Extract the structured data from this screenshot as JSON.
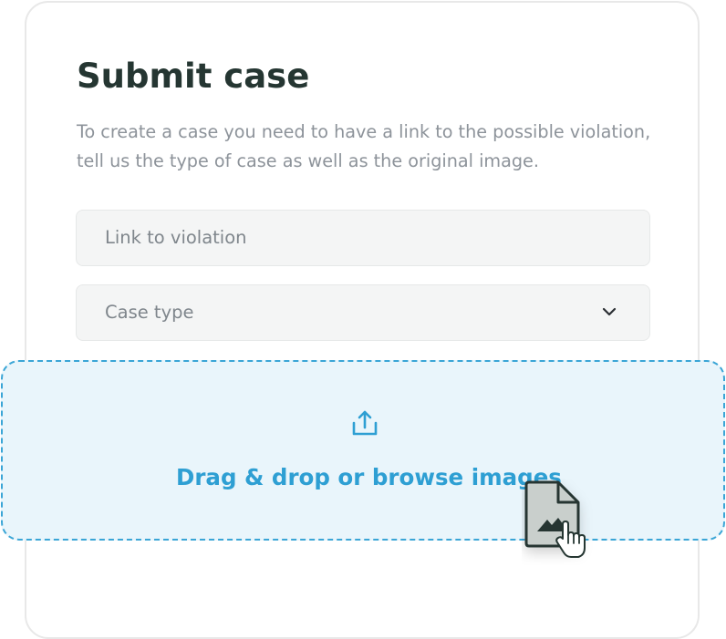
{
  "form": {
    "title": "Submit case",
    "description": "To create a case you need to have a link to the possible violation, tell us the type of case as well as the original image.",
    "link_field": {
      "placeholder": "Link to violation"
    },
    "case_type": {
      "placeholder": "Case type",
      "icon": "chevron-down-icon"
    },
    "dropzone": {
      "text": "Drag & drop or browse images",
      "icon": "upload-icon"
    },
    "dragged_item": {
      "icon": "image-file-icon",
      "cursor": "hand-pointer-icon"
    }
  },
  "colors": {
    "title": "#253632",
    "description": "#8d939a",
    "field_background": "#f4f5f5",
    "field_text": "#7f868c",
    "dropzone_background": "#e9f5fb",
    "accent": "#2e9fd3",
    "file_icon_fill": "#c9cfcc",
    "file_icon_stroke": "#253632"
  }
}
